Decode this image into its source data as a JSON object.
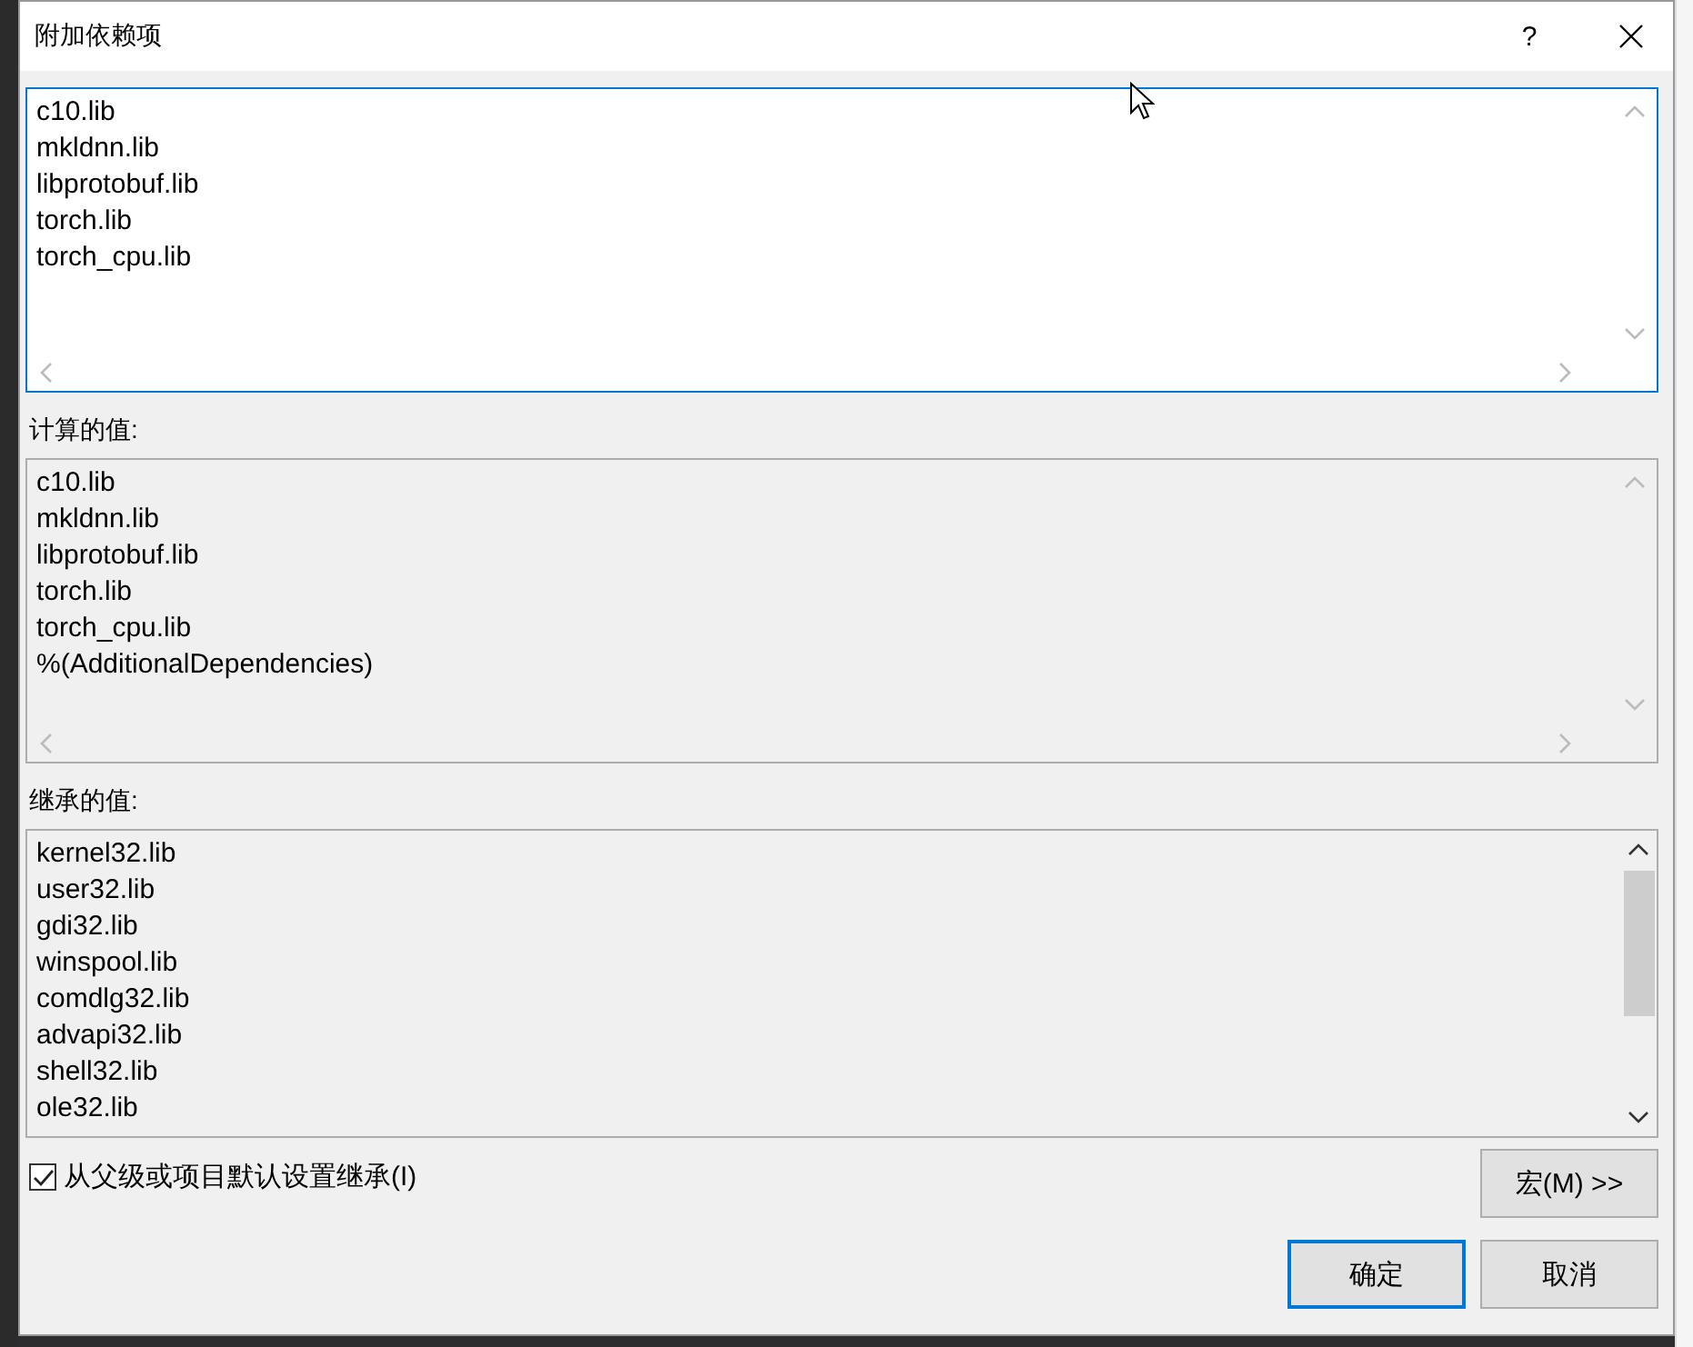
{
  "window": {
    "title": "附加依赖项",
    "help_button": "?"
  },
  "editor": {
    "lines": [
      "c10.lib",
      "mkldnn.lib",
      "libprotobuf.lib",
      "torch.lib",
      "torch_cpu.lib"
    ]
  },
  "evaluated": {
    "label": "计算的值:",
    "lines": [
      "c10.lib",
      "mkldnn.lib",
      "libprotobuf.lib",
      "torch.lib",
      "torch_cpu.lib",
      "%(AdditionalDependencies)"
    ]
  },
  "inherited": {
    "label": "继承的值:",
    "lines": [
      "kernel32.lib",
      "user32.lib",
      "gdi32.lib",
      "winspool.lib",
      "comdlg32.lib",
      "advapi32.lib",
      "shell32.lib",
      "ole32.lib"
    ]
  },
  "inherit_checkbox": {
    "label": "从父级或项目默认设置继承(I)",
    "checked": true
  },
  "buttons": [
    {
      "label": "宏(M) >>",
      "kind": "macro"
    },
    {
      "label": "确定",
      "kind": "default"
    },
    {
      "label": "取消",
      "kind": "normal"
    }
  ]
}
